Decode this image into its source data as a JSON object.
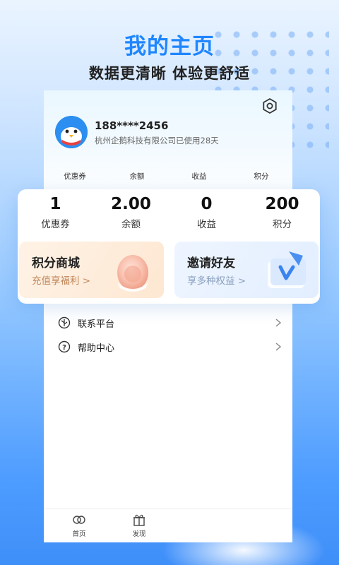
{
  "hero": {
    "title": "我的主页",
    "subtitle": "数据更清晰 体验更舒适"
  },
  "profile": {
    "phone": "188****2456",
    "company_text": "杭州企鹅科技有限公司已使用28天",
    "avatar_icon": "penguin-avatar-icon",
    "settings_icon": "gear-icon"
  },
  "mini_stats": [
    "优惠券",
    "余额",
    "收益",
    "积分"
  ],
  "stats": [
    {
      "value": "1",
      "label": "优惠券"
    },
    {
      "value": "2.00",
      "label": "余额"
    },
    {
      "value": "0",
      "label": "收益"
    },
    {
      "value": "200",
      "label": "积分"
    }
  ],
  "promos": {
    "mall": {
      "title": "积分商城",
      "subtitle": "充值享福利 >"
    },
    "invite": {
      "title": "邀请好友",
      "subtitle": "享多种权益 >"
    }
  },
  "menu": [
    {
      "label": "",
      "icon": "menu-icon"
    },
    {
      "label": "联系平台",
      "icon": "contact-icon"
    },
    {
      "label": "帮助中心",
      "icon": "help-icon"
    }
  ],
  "tabbar": [
    {
      "label": "首页",
      "icon": "home-icon"
    },
    {
      "label": "发现",
      "icon": "gift-icon"
    }
  ],
  "colors": {
    "accent": "#1f86ff",
    "mall_bg": "#fdeedd",
    "invite_bg": "#e8f1ff"
  }
}
